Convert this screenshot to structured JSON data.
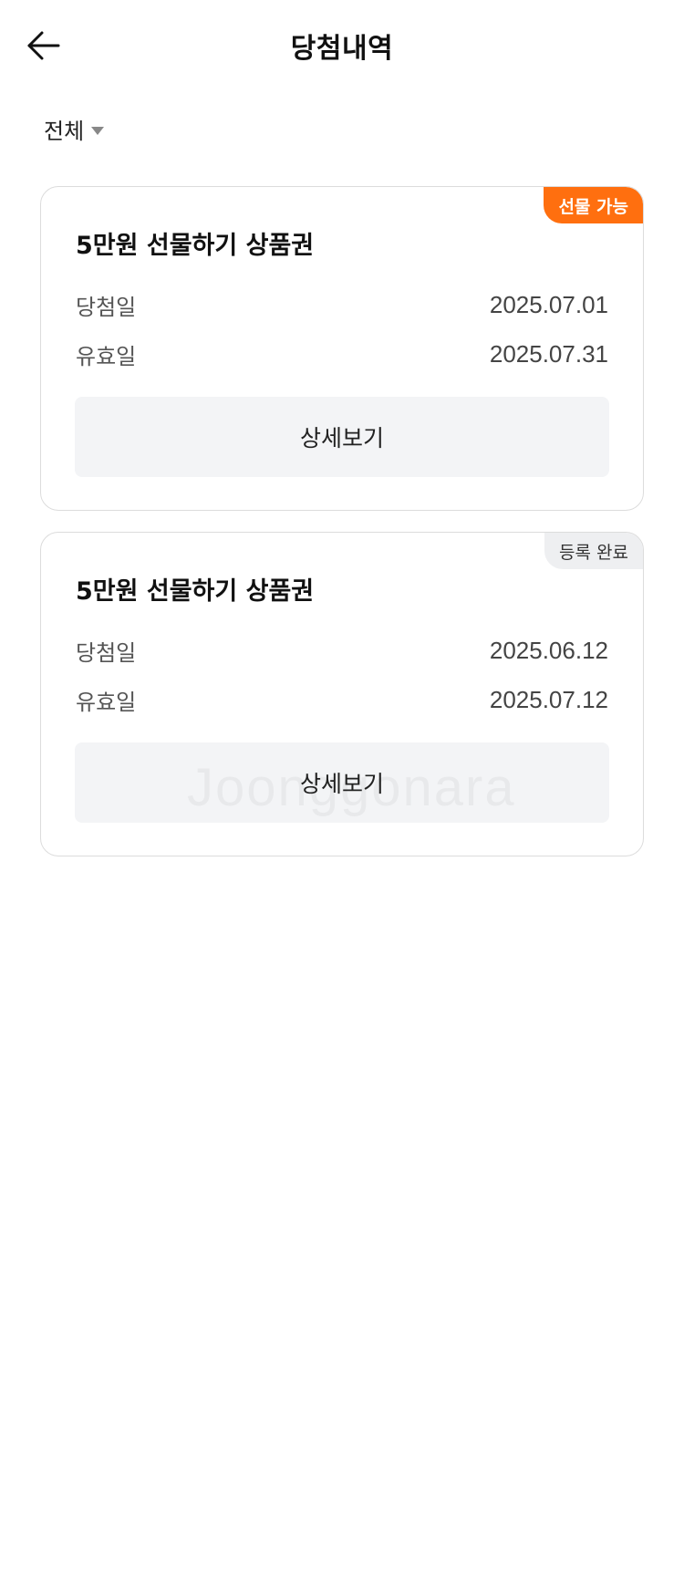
{
  "header": {
    "title": "당첨내역",
    "back_icon": "arrow-left-icon"
  },
  "filter": {
    "label": "전체",
    "icon": "caret-down-icon"
  },
  "cards": [
    {
      "badge": "선물 가능",
      "badge_color": "#ff6f0f",
      "title": "5만원 선물하기 상품권",
      "win_date_label": "당첨일",
      "win_date": "2025.07.01",
      "expiry_label": "유효일",
      "expiry_date": "2025.07.31",
      "button_label": "상세보기"
    },
    {
      "badge": "등록 완료",
      "badge_color": "#eeeff1",
      "title": "5만원 선물하기 상품권",
      "win_date_label": "당첨일",
      "win_date": "2025.06.12",
      "expiry_label": "유효일",
      "expiry_date": "2025.07.12",
      "button_label": "상세보기"
    }
  ],
  "watermark": "Joonggonara"
}
